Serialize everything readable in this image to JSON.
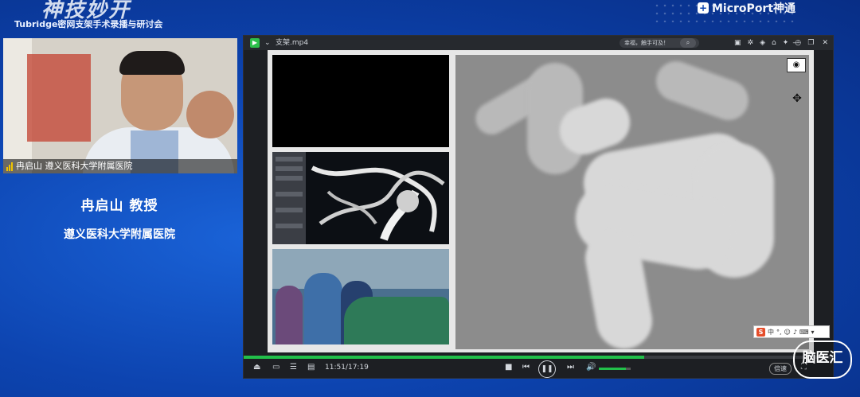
{
  "header": {
    "event_logo": "神技妙开",
    "event_subtitle": "Tubridge密网支架手术录播与研讨会",
    "brand": "MicroPort神通"
  },
  "webcam": {
    "label": "冉启山 遵义医科大学附属医院"
  },
  "speaker": {
    "name": "冉启山 教授",
    "org": "遵义医科大学附属医院"
  },
  "player": {
    "filename": "支架.mp4",
    "search_text": "幸福，触手可及！",
    "current_time": "11:51",
    "total_time": "17:19",
    "time_display": "11:51/17:19",
    "progress": 0.68,
    "volume": 0.85,
    "speed_label": "倍速",
    "accent": "#22c04a"
  },
  "watermark": {
    "text": "脑医汇",
    "sub": "brainmed.com"
  }
}
